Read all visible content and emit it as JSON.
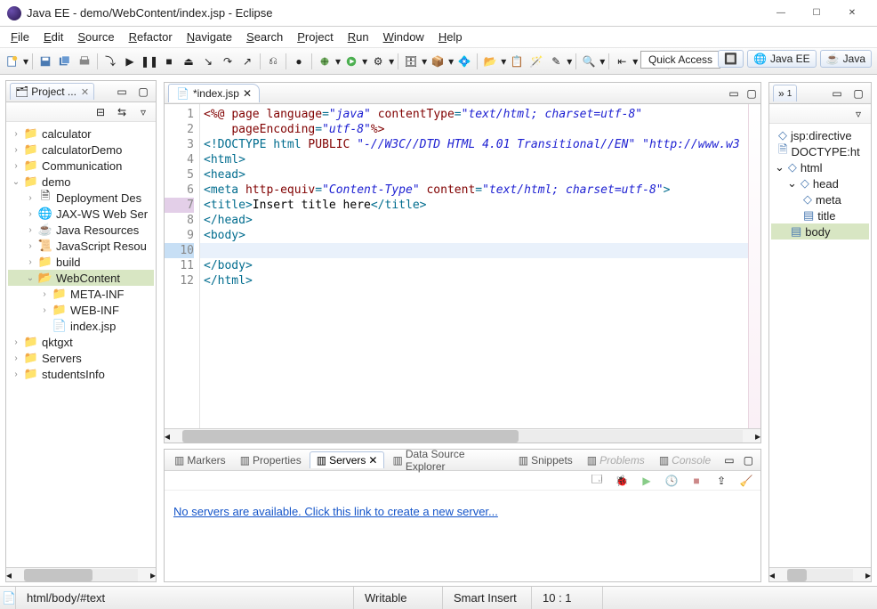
{
  "window": {
    "title": "Java EE - demo/WebContent/index.jsp - Eclipse"
  },
  "menu": [
    "File",
    "Edit",
    "Source",
    "Refactor",
    "Navigate",
    "Search",
    "Project",
    "Run",
    "Window",
    "Help"
  ],
  "quick_access": "Quick Access",
  "perspectives": {
    "javaee": "Java EE",
    "java": "Java"
  },
  "project_explorer": {
    "tab_label": "Project ...",
    "items": [
      {
        "label": "calculator",
        "icon": "project",
        "depth": 0,
        "twisty": ">"
      },
      {
        "label": "calculatorDemo",
        "icon": "project",
        "depth": 0,
        "twisty": ">"
      },
      {
        "label": "Communication",
        "icon": "project",
        "depth": 0,
        "twisty": ">"
      },
      {
        "label": "demo",
        "icon": "project",
        "depth": 0,
        "twisty": "v"
      },
      {
        "label": "Deployment Des",
        "icon": "desc",
        "depth": 1,
        "twisty": ">"
      },
      {
        "label": "JAX-WS Web Ser",
        "icon": "ws",
        "depth": 1,
        "twisty": ">"
      },
      {
        "label": "Java Resources",
        "icon": "jres",
        "depth": 1,
        "twisty": ">"
      },
      {
        "label": "JavaScript Resou",
        "icon": "jsres",
        "depth": 1,
        "twisty": ">"
      },
      {
        "label": "build",
        "icon": "folder",
        "depth": 1,
        "twisty": ">"
      },
      {
        "label": "WebContent",
        "icon": "folder-open",
        "depth": 1,
        "twisty": "v",
        "sel": true
      },
      {
        "label": "META-INF",
        "icon": "folder",
        "depth": 2,
        "twisty": ">"
      },
      {
        "label": "WEB-INF",
        "icon": "folder",
        "depth": 2,
        "twisty": ">"
      },
      {
        "label": "index.jsp",
        "icon": "file",
        "depth": 2,
        "twisty": " "
      },
      {
        "label": "qktgxt",
        "icon": "project",
        "depth": 0,
        "twisty": ">"
      },
      {
        "label": "Servers",
        "icon": "project",
        "depth": 0,
        "twisty": ">"
      },
      {
        "label": "studentsInfo",
        "icon": "project",
        "depth": 0,
        "twisty": ">"
      }
    ]
  },
  "editor": {
    "tab_label": "*index.jsp",
    "gutter": [
      "1",
      "2",
      "3",
      "4",
      "5",
      "6",
      "7",
      "8",
      "9",
      "10",
      "11",
      "12"
    ],
    "current_line_index": 9,
    "highlighted_line_index": 6,
    "lines_html": [
      "<span class='kw'>&lt;%@</span> <span class='kw'>page</span> <span class='kw'>language</span>=<span class='str'>\"java\"</span> <span class='kw'>contentType</span>=<span class='str'>\"text/html; charset=utf-8\"</span>",
      "    <span class='kw'>pageEncoding</span>=<span class='str'>\"utf-8\"</span><span class='kw'>%&gt;</span>",
      "<span class='tag'>&lt;!DOCTYPE</span> <span class='tag'>html</span> <span class='kw'>PUBLIC</span> <span class='str'>\"-//W3C//DTD HTML 4.01 Transitional//EN\"</span> <span class='str'>\"http://www.w3</span>",
      "<span class='tag'>&lt;html&gt;</span>",
      "<span class='tag'>&lt;head&gt;</span>",
      "<span class='tag'>&lt;meta</span> <span class='kw'>http-equiv</span>=<span class='str'>\"Content-Type\"</span> <span class='kw'>content</span>=<span class='str'>\"text/html; charset=utf-8\"</span><span class='tag'>&gt;</span>",
      "<span class='tag'>&lt;title&gt;</span><span class='txt'>Insert title here</span><span class='tag'>&lt;/title&gt;</span>",
      "<span class='tag'>&lt;/head&gt;</span>",
      "<span class='tag'>&lt;body&gt;</span>",
      "",
      "<span class='tag'>&lt;/body&gt;</span>",
      "<span class='tag'>&lt;/html&gt;</span>"
    ]
  },
  "bottom": {
    "tabs": [
      "Markers",
      "Properties",
      "Servers",
      "Data Source Explorer",
      "Snippets",
      "Problems",
      "Console"
    ],
    "active_index": 2,
    "message": "No servers are available. Click this link to create a new server..."
  },
  "outline": {
    "tab_glyph": "»",
    "tab_sub": "1",
    "items": [
      {
        "label": "jsp:directive",
        "icon": "diamond",
        "depth": 0,
        "twisty": " "
      },
      {
        "label": "DOCTYPE:ht",
        "icon": "doc",
        "depth": 0,
        "twisty": " "
      },
      {
        "label": "html",
        "icon": "diamond",
        "depth": 0,
        "twisty": "v"
      },
      {
        "label": "head",
        "icon": "diamond",
        "depth": 1,
        "twisty": "v"
      },
      {
        "label": "meta",
        "icon": "diamond",
        "depth": 2,
        "twisty": " "
      },
      {
        "label": "title",
        "icon": "page",
        "depth": 2,
        "twisty": " "
      },
      {
        "label": "body",
        "icon": "page",
        "depth": 1,
        "twisty": " ",
        "sel": true
      }
    ]
  },
  "status": {
    "path": "html/body/#text",
    "writable": "Writable",
    "insert": "Smart Insert",
    "pos": "10 : 1"
  }
}
